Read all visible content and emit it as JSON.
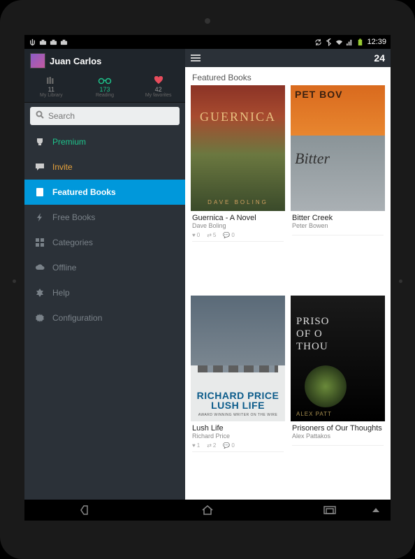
{
  "status": {
    "time": "12:39"
  },
  "user": {
    "name": "Juan Carlos"
  },
  "stats": {
    "library": {
      "count": "11",
      "label": "My Library"
    },
    "reading": {
      "count": "173",
      "label": "Reading"
    },
    "favorites": {
      "count": "42",
      "label": "My favorites"
    }
  },
  "search": {
    "placeholder": "Search"
  },
  "menu": {
    "premium": "Premium",
    "invite": "Invite",
    "featured": "Featured Books",
    "free": "Free Books",
    "categories": "Categories",
    "offline": "Offline",
    "help": "Help",
    "configuration": "Configuration"
  },
  "content": {
    "logo": "24",
    "section_title": "Featured Books",
    "books": [
      {
        "title": "Guernica - A Novel",
        "author": "Dave Boling",
        "likes": "0",
        "shares": "5",
        "comments": "0"
      },
      {
        "title": "Bitter Creek",
        "author": "Peter Bowen",
        "likes": "",
        "shares": "",
        "comments": ""
      },
      {
        "title": "Lush Life",
        "author": "Richard Price",
        "likes": "1",
        "shares": "2",
        "comments": "0"
      },
      {
        "title": "Prisoners of Our Thoughts",
        "author": "Alex Pattakos",
        "likes": "",
        "shares": "",
        "comments": ""
      }
    ]
  }
}
